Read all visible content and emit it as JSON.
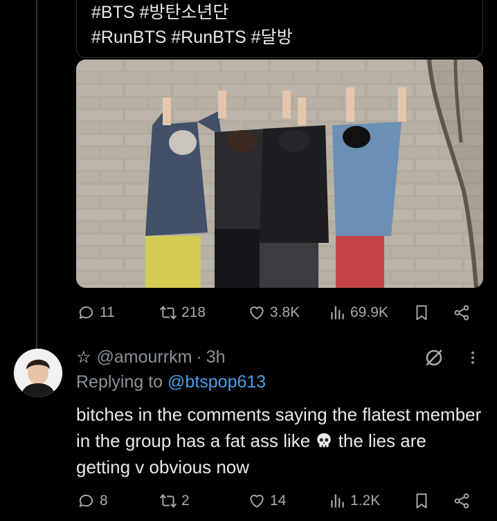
{
  "quoted_tweet": {
    "hashtags_line1": "#BTS #방탄소년단",
    "hashtags_line2": "#RunBTS #RunBTS #달방"
  },
  "main_tweet_actions": {
    "replies": "11",
    "retweets": "218",
    "likes": "3.8K",
    "views": "69.9K"
  },
  "reply": {
    "handle": "@amourrkm",
    "separator": "·",
    "time": "3h",
    "replying_prefix": "Replying to",
    "replying_to": "@btspop613",
    "text_before_emoji": "bitches in the comments saying the flatest member in the group has a fat ass like",
    "text_after_emoji": "the lies are getting v obvious now",
    "emoji": "skull-emoji",
    "actions": {
      "replies": "8",
      "retweets": "2",
      "likes": "14",
      "views": "1.2K"
    }
  },
  "colors": {
    "background": "#000000",
    "text": "#e7e9ea",
    "muted": "#8b9298",
    "link": "#4a9eea",
    "icon": "#a6abaf"
  }
}
